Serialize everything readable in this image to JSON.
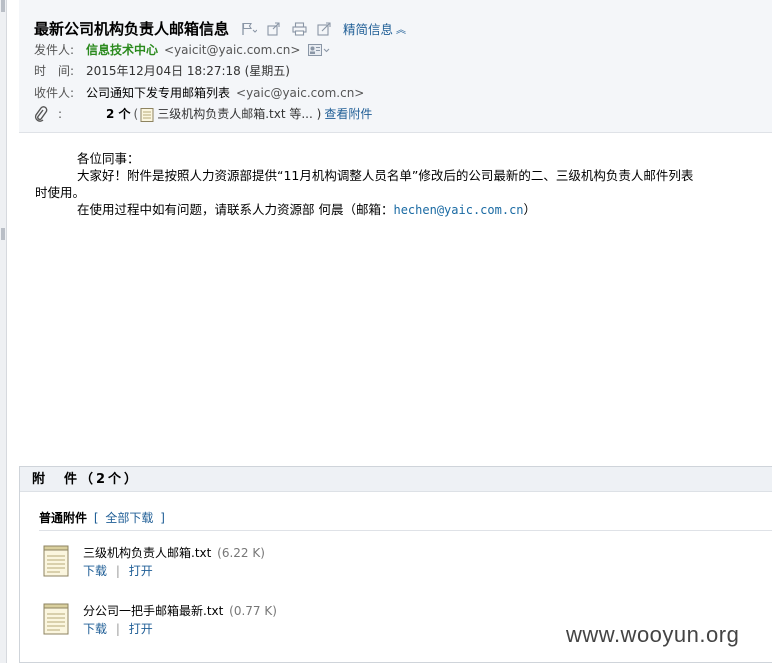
{
  "header": {
    "subject": "最新公司机构负责人邮箱信息",
    "concise_label": "精简信息",
    "toolbar_icons": [
      "flag-icon",
      "forward-icon",
      "print-icon",
      "popout-icon"
    ],
    "from_label": "发件人:",
    "from_name": "信息技术中心",
    "from_addr": "<yaicit@yaic.com.cn>",
    "time_label": "时　间:",
    "time_value": "2015年12月04日 18:27:18 (星期五)",
    "to_label": "收件人:",
    "to_name": "公司通知下发专用邮箱列表",
    "to_addr": "<yaic@yaic.com.cn>",
    "attach_label": ":",
    "attach_count": "2 个",
    "attach_brief_open": "(",
    "attach_brief": "三级机构负责人邮箱.txt 等... )",
    "view_attach": "查看附件"
  },
  "body": {
    "line1": "各位同事：",
    "line2": "大家好！附件是按照人力资源部提供“11月机构调整人员名单”修改后的公司最新的二、三级机构负责人邮件列表",
    "line3": "时使用。",
    "line4_prefix": "在使用过程中如有问题，请联系人力资源部 何晨（邮箱：",
    "line4_email": "hechen@yaic.com.cn",
    "line4_suffix": "）"
  },
  "attachments": {
    "heading": "附　件（2个）",
    "sub_label": "普通附件",
    "bracket_open": "[",
    "download_all": "全部下载",
    "bracket_close": "]",
    "files": [
      {
        "name": "三级机构负责人邮箱.txt",
        "size": "(6.22 K)",
        "download": "下载",
        "sep": "|",
        "open": "打开"
      },
      {
        "name": "分公司一把手邮箱最新.txt",
        "size": "(0.77 K)",
        "download": "下载",
        "sep": "|",
        "open": "打开"
      }
    ]
  },
  "watermark": "www.wooyun.org",
  "colors": {
    "link": "#1f5e96",
    "sender": "#2b8a1e",
    "header_bg": "#f4f6f9"
  }
}
